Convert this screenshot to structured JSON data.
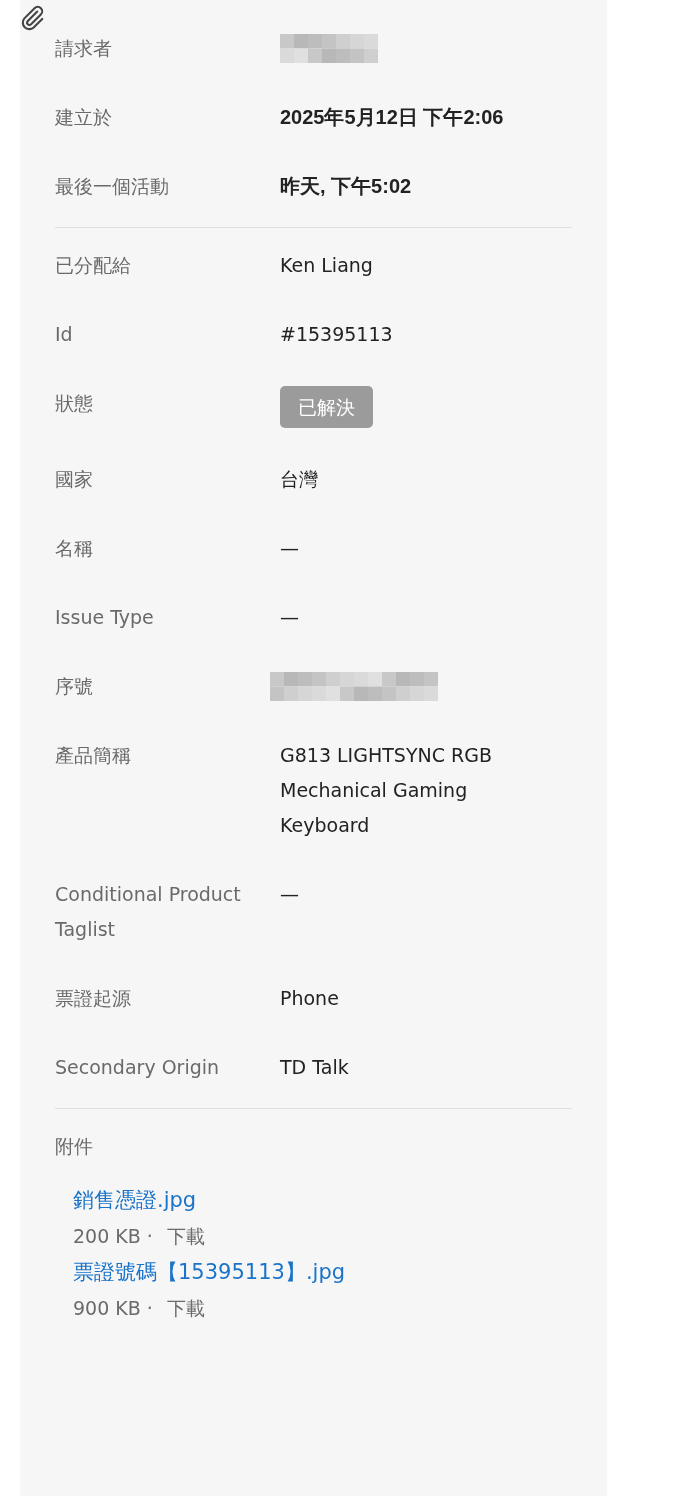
{
  "sections": [
    {
      "rows": [
        {
          "label": "請求者",
          "kind": "redacted"
        },
        {
          "label": "建立於",
          "kind": "text",
          "value": "2025年5月12日 下午2:06",
          "bold": true
        },
        {
          "label": "最後一個活動",
          "kind": "text",
          "value": "昨天, 下午5:02",
          "bold": true
        }
      ]
    },
    {
      "rows": [
        {
          "label": "已分配給",
          "kind": "text",
          "value": "Ken Liang"
        },
        {
          "label": "Id",
          "kind": "text",
          "value": "#15395113"
        },
        {
          "label": "狀態",
          "kind": "badge",
          "value": "已解決"
        },
        {
          "label": "國家",
          "kind": "text",
          "value": "台灣"
        },
        {
          "label": "名稱",
          "kind": "text",
          "value": "—"
        },
        {
          "label": "Issue Type",
          "kind": "text",
          "value": "—"
        },
        {
          "label": "序號",
          "kind": "redacted"
        },
        {
          "label": "產品簡稱",
          "kind": "text",
          "value": "G813 LIGHTSYNC RGB Mechanical Gaming Keyboard"
        },
        {
          "label": "Conditional Product Taglist",
          "kind": "text",
          "value": "—"
        },
        {
          "label": "票證起源",
          "kind": "text",
          "value": "Phone"
        },
        {
          "label": "Secondary Origin",
          "kind": "text",
          "value": "TD Talk"
        }
      ]
    }
  ],
  "attachments": {
    "label": "附件",
    "files": [
      {
        "name": "銷售憑證.jpg",
        "size": "200 KB ·",
        "action": "下載"
      },
      {
        "name": "票證號碼【15395113】.jpg",
        "size": "900 KB ·",
        "action": "下載"
      }
    ]
  }
}
